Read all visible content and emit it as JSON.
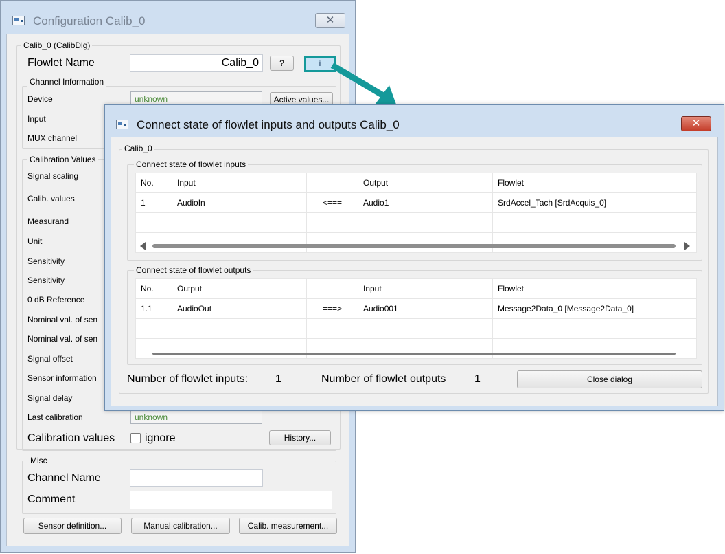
{
  "back_window": {
    "title": "Configuration Calib_0",
    "close_glyph": "✕",
    "group_main_title": "Calib_0 (CalibDlg)",
    "flowlet_name_label": "Flowlet Name",
    "flowlet_name_value": "Calib_0",
    "help_button": "?",
    "info_button": "i",
    "channel_info_title": "Channel Information",
    "device_label": "Device",
    "device_value": "unknown",
    "active_values_button": "Active values...",
    "input_label": "Input",
    "mux_label": "MUX channel",
    "calibration_values_title": "Calibration Values",
    "rows": [
      "Signal scaling",
      "Calib. values",
      "Measurand",
      "Unit",
      "Sensitivity",
      "Sensitivity",
      "0 dB Reference",
      "Nominal val. of sen",
      "Nominal val. of sen",
      "Signal offset",
      "Sensor information",
      "Signal delay",
      "Last calibration"
    ],
    "last_calibration_value": "unknown",
    "calibration_values_label": "Calibration values",
    "ignore_label": "ignore",
    "history_button": "History...",
    "misc_title": "Misc",
    "channel_name_label": "Channel Name",
    "comment_label": "Comment",
    "sensor_definition_button": "Sensor definition...",
    "manual_calibration_button": "Manual calibration...",
    "calib_measurement_button": "Calib. measurement..."
  },
  "front_dialog": {
    "title": "Connect state of flowlet inputs and outputs Calib_0",
    "close_glyph": "✕",
    "group_title": "Calib_0",
    "inputs_title": "Connect state of flowlet inputs",
    "inputs_table": {
      "headers": [
        "No.",
        "Input",
        "",
        "Output",
        "Flowlet"
      ],
      "rows": [
        [
          "1",
          "AudioIn",
          "<===",
          "Audio1",
          "SrdAccel_Tach [SrdAcquis_0]"
        ]
      ]
    },
    "outputs_title": "Connect state of flowlet outputs",
    "outputs_table": {
      "headers": [
        "No.",
        "Output",
        "",
        "Input",
        "Flowlet"
      ],
      "rows": [
        [
          "1.1",
          "AudioOut",
          "===>",
          "Audio001",
          "Message2Data_0 [Message2Data_0]"
        ]
      ]
    },
    "num_inputs_label": "Number of flowlet inputs:",
    "num_inputs_value": "1",
    "num_outputs_label": "Number of flowlet outputs",
    "num_outputs_value": "1",
    "close_dialog_button": "Close dialog"
  },
  "colors": {
    "annotation_arrow": "#14999a",
    "window_frame": "#cfdff1",
    "green_text": "#4a8a38"
  }
}
